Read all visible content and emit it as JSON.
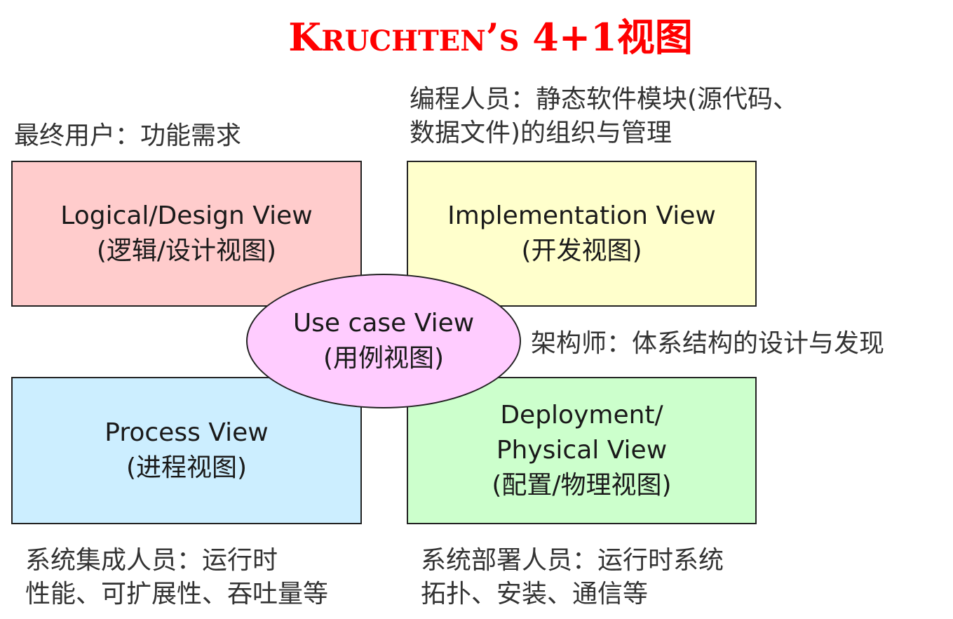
{
  "title": {
    "k_cap": "K",
    "k_rest": "RUCHTEN",
    "apos": "’",
    "s_cap": "S",
    "tail": " 4+1视图"
  },
  "notes": {
    "end_user": "最终用户：功能需求",
    "programmer_line1": "编程人员：静态软件模块(源代码、",
    "programmer_line2": "数据文件)的组织与管理",
    "architect": "架构师：体系结构的设计与发现",
    "integrator_line1": "系统集成人员：运行时",
    "integrator_line2": "性能、可扩展性、吞吐量等",
    "deployer_line1": "系统部署人员：运行时系统",
    "deployer_line2": "拓扑、安装、通信等"
  },
  "views": {
    "logical": {
      "en": "Logical/Design View",
      "zh": "(逻辑/设计视图)"
    },
    "implementation": {
      "en": "Implementation View",
      "zh": "(开发视图)"
    },
    "usecase": {
      "en": "Use case View",
      "zh": "(用例视图)"
    },
    "process": {
      "en": "Process View",
      "zh": "(进程视图)"
    },
    "deployment": {
      "en1": "Deployment/",
      "en2": "Physical View",
      "zh": "(配置/物理视图)"
    }
  },
  "colors": {
    "title": "#ff0000",
    "logical": "#ffcccc",
    "implementation": "#ffffcc",
    "usecase": "#ffccff",
    "process": "#cceeff",
    "deployment": "#ccffcc"
  }
}
